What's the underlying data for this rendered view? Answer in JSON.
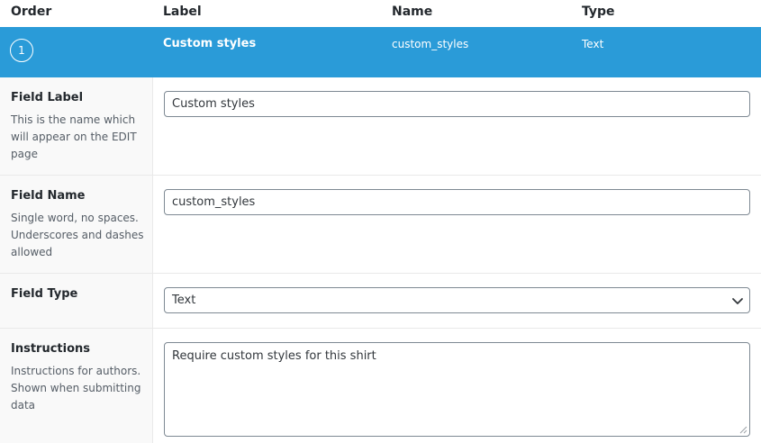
{
  "table_header": {
    "order": "Order",
    "label": "Label",
    "name": "Name",
    "type": "Type"
  },
  "field": {
    "order": "1",
    "label": "Custom styles",
    "name": "custom_styles",
    "type": "Text"
  },
  "settings": {
    "field_label": {
      "title": "Field Label",
      "description": "This is the name which will appear on the EDIT page",
      "value": "Custom styles"
    },
    "field_name": {
      "title": "Field Name",
      "description": "Single word, no spaces. Underscores and dashes allowed",
      "value": "custom_styles"
    },
    "field_type": {
      "title": "Field Type",
      "selected": "Text"
    },
    "instructions": {
      "title": "Instructions",
      "description": "Instructions for authors. Shown when submitting data",
      "value": "Require custom styles for this shirt"
    }
  },
  "icons": {
    "dropdown": "chevron-down-icon",
    "resize": "resize-handle-icon"
  },
  "colors": {
    "selected_row": "#2a9bd8",
    "label_column_bg": "#f9f9f9",
    "input_border": "#7e8993"
  }
}
